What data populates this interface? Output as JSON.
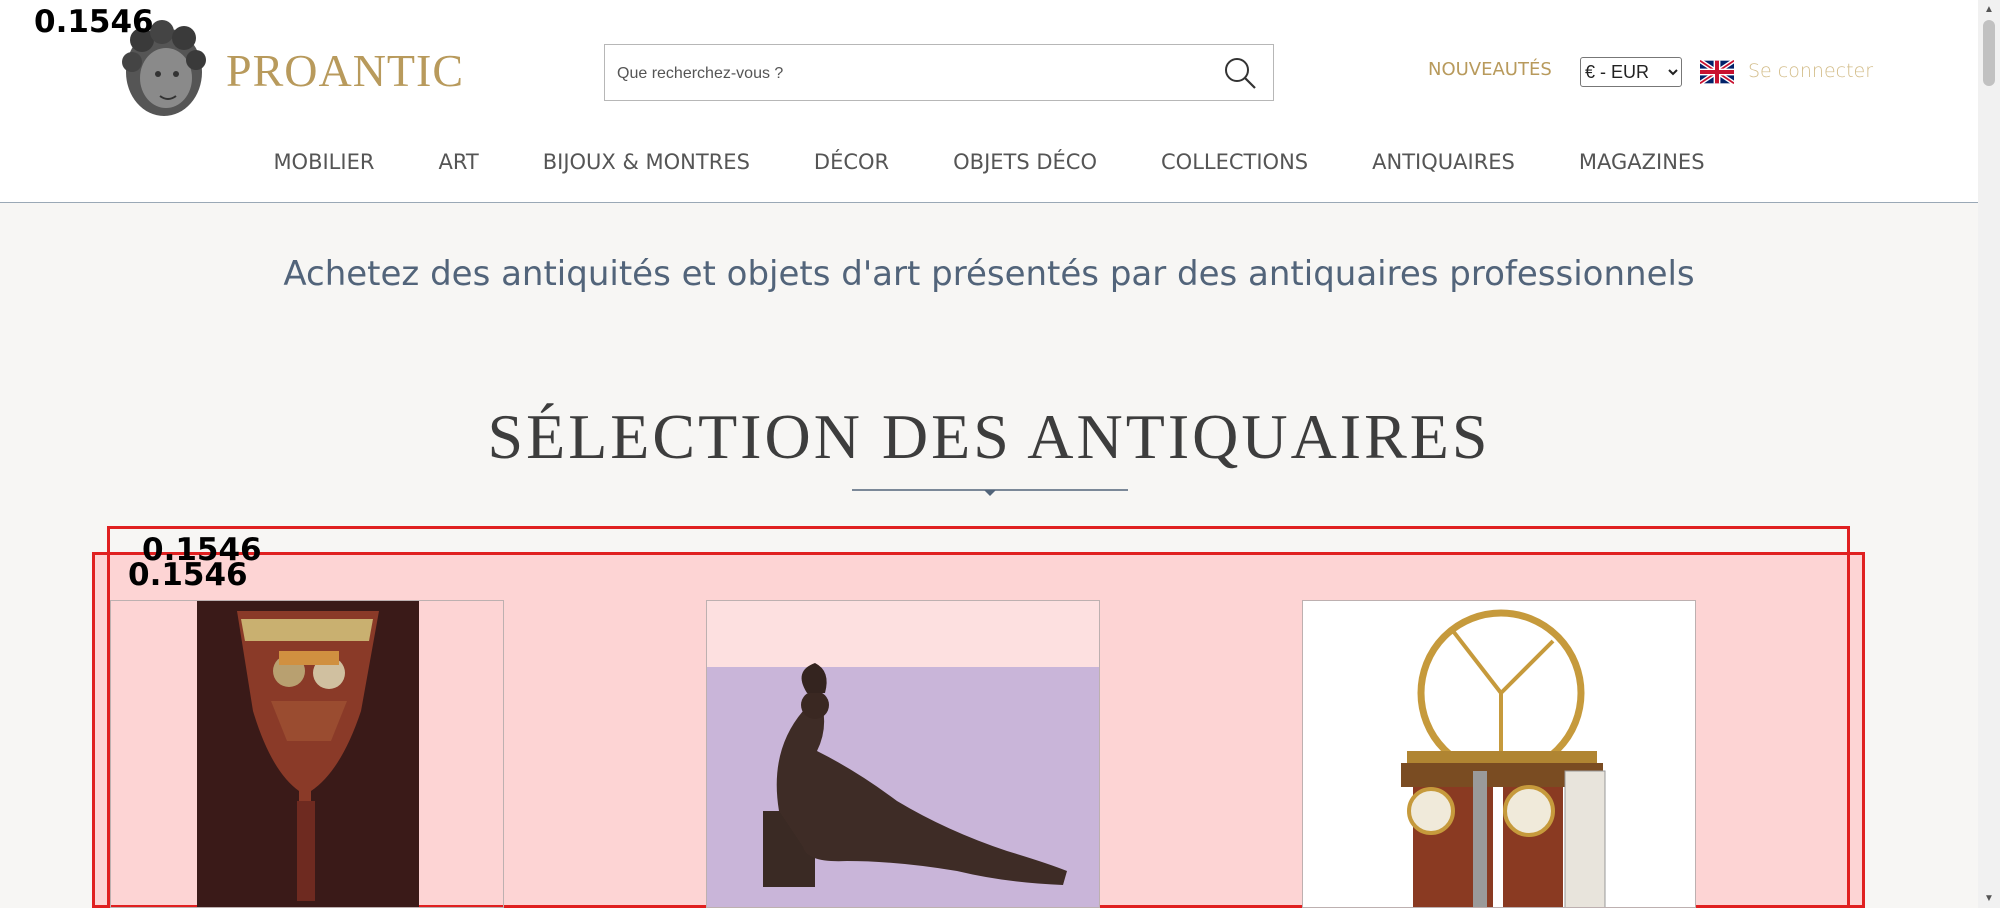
{
  "header": {
    "brand": "PROANTIC",
    "search_placeholder": "Que recherchez-vous ?",
    "new_link": "NOUVEAUTÉS",
    "currency": "€ - EUR",
    "login": "Se connecter",
    "nav": [
      "MOBILIER",
      "ART",
      "BIJOUX & MONTRES",
      "DÉCOR",
      "OBJETS DÉCO",
      "COLLECTIONS",
      "ANTIQUAIRES",
      "MAGAZINES"
    ]
  },
  "main": {
    "tagline": "Achetez des antiquités et objets d'art présentés par des antiquaires professionnels",
    "section_title": "SÉLECTION DES ANTIQUAIRES"
  },
  "overlay": {
    "scores": [
      "0.1546",
      "0.1546",
      "0.1546"
    ]
  },
  "colors": {
    "accent_gold": "#b89a5c",
    "tagline_blue": "#52647a",
    "highlight_red": "#e02020"
  },
  "icons": {
    "search": "search-icon",
    "flag": "uk-flag-icon"
  }
}
